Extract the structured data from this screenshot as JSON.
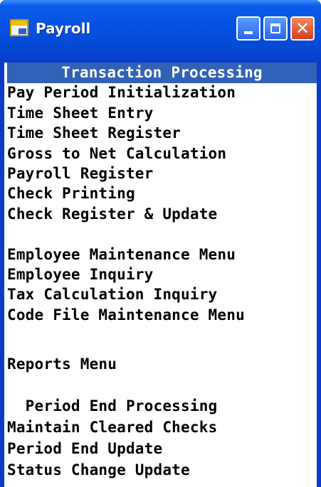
{
  "window": {
    "title": "Payroll",
    "controls": {
      "minimize": "minimize",
      "maximize": "maximize",
      "close": "close"
    }
  },
  "menu": {
    "items": [
      {
        "label": "Transaction Processing",
        "selected": true
      },
      {
        "label": "Pay Period Initialization"
      },
      {
        "label": "Time Sheet Entry"
      },
      {
        "label": "Time Sheet Register"
      },
      {
        "label": "Gross to Net Calculation"
      },
      {
        "label": "Payroll Register"
      },
      {
        "label": "Check Printing"
      },
      {
        "label": "Check Register & Update"
      },
      {
        "label": ""
      },
      {
        "label": "Employee Maintenance Menu"
      },
      {
        "label": "Employee Inquiry"
      },
      {
        "label": "Tax Calculation Inquiry"
      },
      {
        "label": "Code File Maintenance Menu"
      },
      {
        "label": ""
      },
      {
        "label": "Reports Menu"
      },
      {
        "label": ""
      },
      {
        "label": "  Period End Processing"
      },
      {
        "label": "Maintain Cleared Checks"
      },
      {
        "label": "Period End Update"
      },
      {
        "label": "Status Change Update"
      }
    ]
  },
  "colors": {
    "titlebar": "#0550e0",
    "selection": "#3162b8",
    "close": "#d4401c"
  }
}
